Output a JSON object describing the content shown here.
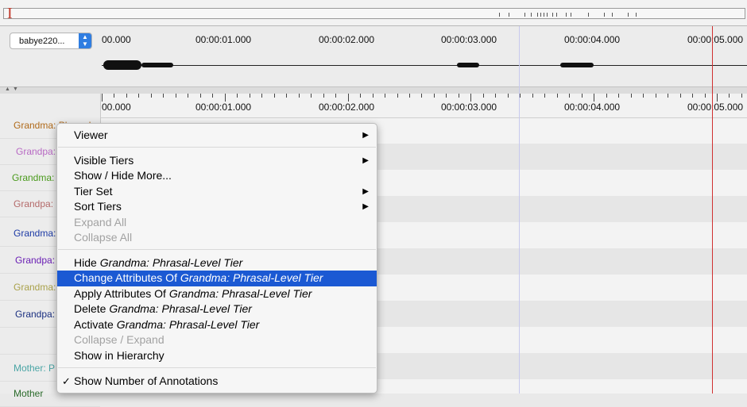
{
  "media": {
    "selected": "babye220..."
  },
  "ruler": {
    "labels": [
      "00.000",
      "00:00:01.000",
      "00:00:02.000",
      "00:00:03.000",
      "00:00:04.000",
      "00:00:05.000"
    ]
  },
  "tiers": [
    {
      "label": "Grandma: Phrasal",
      "color": "#b06a1a"
    },
    {
      "label": "Grandpa:",
      "color": "#b86ac4"
    },
    {
      "label": "Grandma:",
      "color": "#4a9a1c"
    },
    {
      "label": "Grandpa:",
      "color": "#b46a6a"
    },
    {
      "label": "Grandma:",
      "color": "#1d3aa5"
    },
    {
      "label": "Grandpa:",
      "color": "#6a1fb4"
    },
    {
      "label": "Grandma:",
      "color": "#a9a14a"
    },
    {
      "label": "Grandpa:",
      "color": "#1a2f80"
    },
    {
      "label": "",
      "color": "#000000"
    },
    {
      "label": "Mother: P",
      "color": "#4aa5a5"
    },
    {
      "label": "Mother",
      "color": "#2a6a2a"
    }
  ],
  "menu": {
    "viewer": "Viewer",
    "visible_tiers": "Visible Tiers",
    "show_hide_more": "Show / Hide More...",
    "tier_set": "Tier Set",
    "sort_tiers": "Sort Tiers",
    "expand_all": "Expand All",
    "collapse_all": "Collapse All",
    "hide_prefix": "Hide",
    "change_prefix": "Change Attributes Of",
    "apply_prefix": "Apply Attributes Of",
    "delete_prefix": "Delete",
    "activate_prefix": "Activate",
    "tier_name": "Grandma: Phrasal-Level Tier",
    "collapse_expand": "Collapse / Expand",
    "show_in_hierarchy": "Show in Hierarchy",
    "show_number": "Show Number of Annotations",
    "check_mark": "✓",
    "submenu_arrow": "▶"
  }
}
